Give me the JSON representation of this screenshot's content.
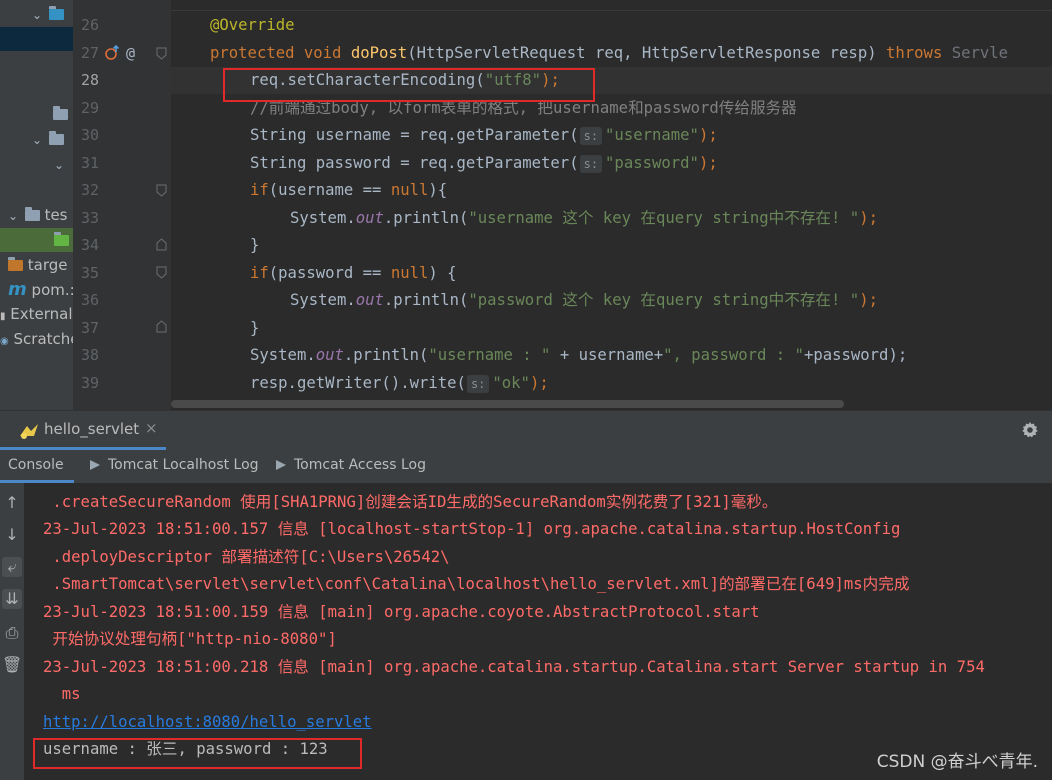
{
  "project_tree": {
    "items": [
      {
        "label": "tes"
      },
      {
        "label": "targe"
      },
      {
        "label": "pom.:"
      },
      {
        "label": "External"
      },
      {
        "label": "Scratche"
      }
    ],
    "pom_icon": "m"
  },
  "gutter": {
    "line_numbers": [
      "26",
      "27",
      "28",
      "29",
      "30",
      "31",
      "32",
      "33",
      "34",
      "35",
      "36",
      "37",
      "38",
      "39"
    ],
    "override_icon": "override-up-icon",
    "at_icon": "@"
  },
  "editor": {
    "l26": {
      "ann": "@Override"
    },
    "l27": {
      "kw1": "protected",
      "kw2": "void",
      "fn": "doPost",
      "args": "(HttpServletRequest req, HttpServletResponse resp) ",
      "kw3": "throws",
      "rest": " Servle"
    },
    "l28": {
      "a": "req.setCharacterEncoding(",
      "s": "\"utf8\"",
      "b": ");"
    },
    "l29": {
      "cmt": "//前端通过body, 以form表单的格式, 把username和password传给服务器"
    },
    "l30": {
      "a": "String username = req.getParameter(",
      "hint": "s:",
      "s": "\"username\"",
      "b": ");"
    },
    "l31": {
      "a": "String password = req.getParameter(",
      "hint": "s:",
      "s": "\"password\"",
      "b": ");"
    },
    "l32": {
      "kw": "if",
      "a": "(username == ",
      "kw2": "null",
      "b": "){"
    },
    "l33": {
      "a": "System.",
      "st": "out",
      "b": ".println(",
      "s": "\"username 这个 key 在query string中不存在! \"",
      "c": ");"
    },
    "l34": {
      "a": "}"
    },
    "l35": {
      "kw": "if",
      "a": "(password == ",
      "kw2": "null",
      "b": ") {"
    },
    "l36": {
      "a": "System.",
      "st": "out",
      "b": ".println(",
      "s": "\"password 这个 key 在query string中不存在! \"",
      "c": ");"
    },
    "l37": {
      "a": "}"
    },
    "l38": {
      "a": "System.",
      "st": "out",
      "b": ".println(",
      "s1": "\"username : \"",
      "c": " + username+",
      "s2": "\", password : \"",
      "d": "+password);"
    },
    "l39": {
      "a": "resp.getWriter().write(",
      "hint": "s:",
      "s": "\"ok\"",
      "b": ");"
    }
  },
  "run_window": {
    "config_name": "hello_servlet",
    "close": "×",
    "gear_icon": "gear-icon",
    "tabs": [
      "Console",
      "Tomcat Localhost Log",
      "Tomcat Access Log"
    ]
  },
  "console": {
    "lines": [
      " .createSecureRandom 使用[SHA1PRNG]创建会话ID生成的SecureRandom实例花费了[321]毫秒。",
      "23-Jul-2023 18:51:00.157 信息 [localhost-startStop-1] org.apache.catalina.startup.HostConfig",
      " .deployDescriptor 部署描述符[C:\\Users\\26542\\",
      " .SmartTomcat\\servlet\\servlet\\conf\\Catalina\\localhost\\hello_servlet.xml]的部署已在[649]ms内完成",
      "23-Jul-2023 18:51:00.159 信息 [main] org.apache.coyote.AbstractProtocol.start",
      " 开始协议处理句柄[\"http-nio-8080\"]",
      "23-Jul-2023 18:51:00.218 信息 [main] org.apache.catalina.startup.Catalina.start Server startup in 754",
      "  ms"
    ],
    "link": "http://localhost:8080/hello_servlet",
    "output": "username : 张三, password : 123"
  },
  "watermark": "CSDN @奋斗べ青年.",
  "colors": {
    "highlight_box": "#e02a2a",
    "error_text": "#ff6b68",
    "link": "#287bde"
  }
}
